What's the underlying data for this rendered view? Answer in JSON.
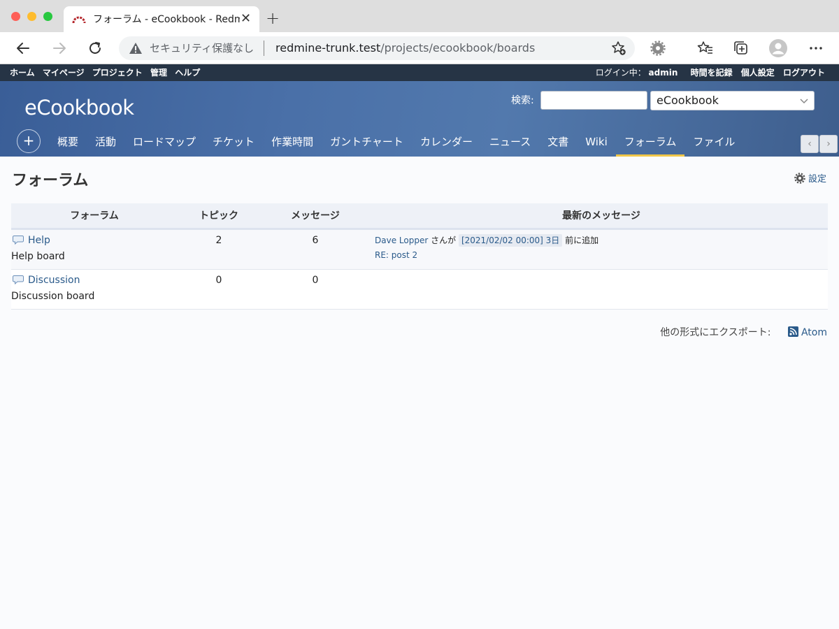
{
  "browser": {
    "tab_title": "フォーラム - eCookbook - Redmine",
    "tab_close": "✕",
    "new_tab": "+",
    "security_label": "セキュリティ保護なし",
    "url_host": "redmine-trunk.test",
    "url_path": "/projects/ecookbook/boards"
  },
  "top_menu": {
    "items": [
      "ホーム",
      "マイページ",
      "プロジェクト",
      "管理",
      "ヘルプ"
    ],
    "logged_as_prefix": "ログイン中：",
    "user": "admin",
    "right_items": [
      "時間を記録",
      "個人設定",
      "ログアウト"
    ]
  },
  "header": {
    "project_title": "eCookbook",
    "search_label": "検索:",
    "search_value": "",
    "project_select": "eCookbook",
    "plus": "+"
  },
  "main_menu": {
    "items": [
      "概要",
      "活動",
      "ロードマップ",
      "チケット",
      "作業時間",
      "ガントチャート",
      "カレンダー",
      "ニュース",
      "文書",
      "Wiki",
      "フォーラム",
      "ファイル"
    ],
    "selected": "フォーラム",
    "scroll_left": "‹",
    "scroll_right": "›"
  },
  "page": {
    "title": "フォーラム",
    "settings_label": "設定"
  },
  "boards_table": {
    "headers": [
      "フォーラム",
      "トピック",
      "メッセージ",
      "最新のメッセージ"
    ],
    "rows": [
      {
        "name": "Help",
        "description": "Help board",
        "topics": "2",
        "messages": "6",
        "last_author": "Dave Lopper",
        "last_by": "さんが",
        "last_stamp": "[2021/02/02 00:00] 3日",
        "last_suffix": "前に追加",
        "last_subject": "RE: post 2"
      },
      {
        "name": "Discussion",
        "description": "Discussion board",
        "topics": "0",
        "messages": "0"
      }
    ]
  },
  "export": {
    "label": "他の形式にエクスポート:",
    "atom": "Atom"
  },
  "colors": {
    "top_menu_bg": "#263445",
    "header_bg": "#4a70a8",
    "selected_tab_underline": "#f0c648",
    "link": "#2a5a8a"
  }
}
